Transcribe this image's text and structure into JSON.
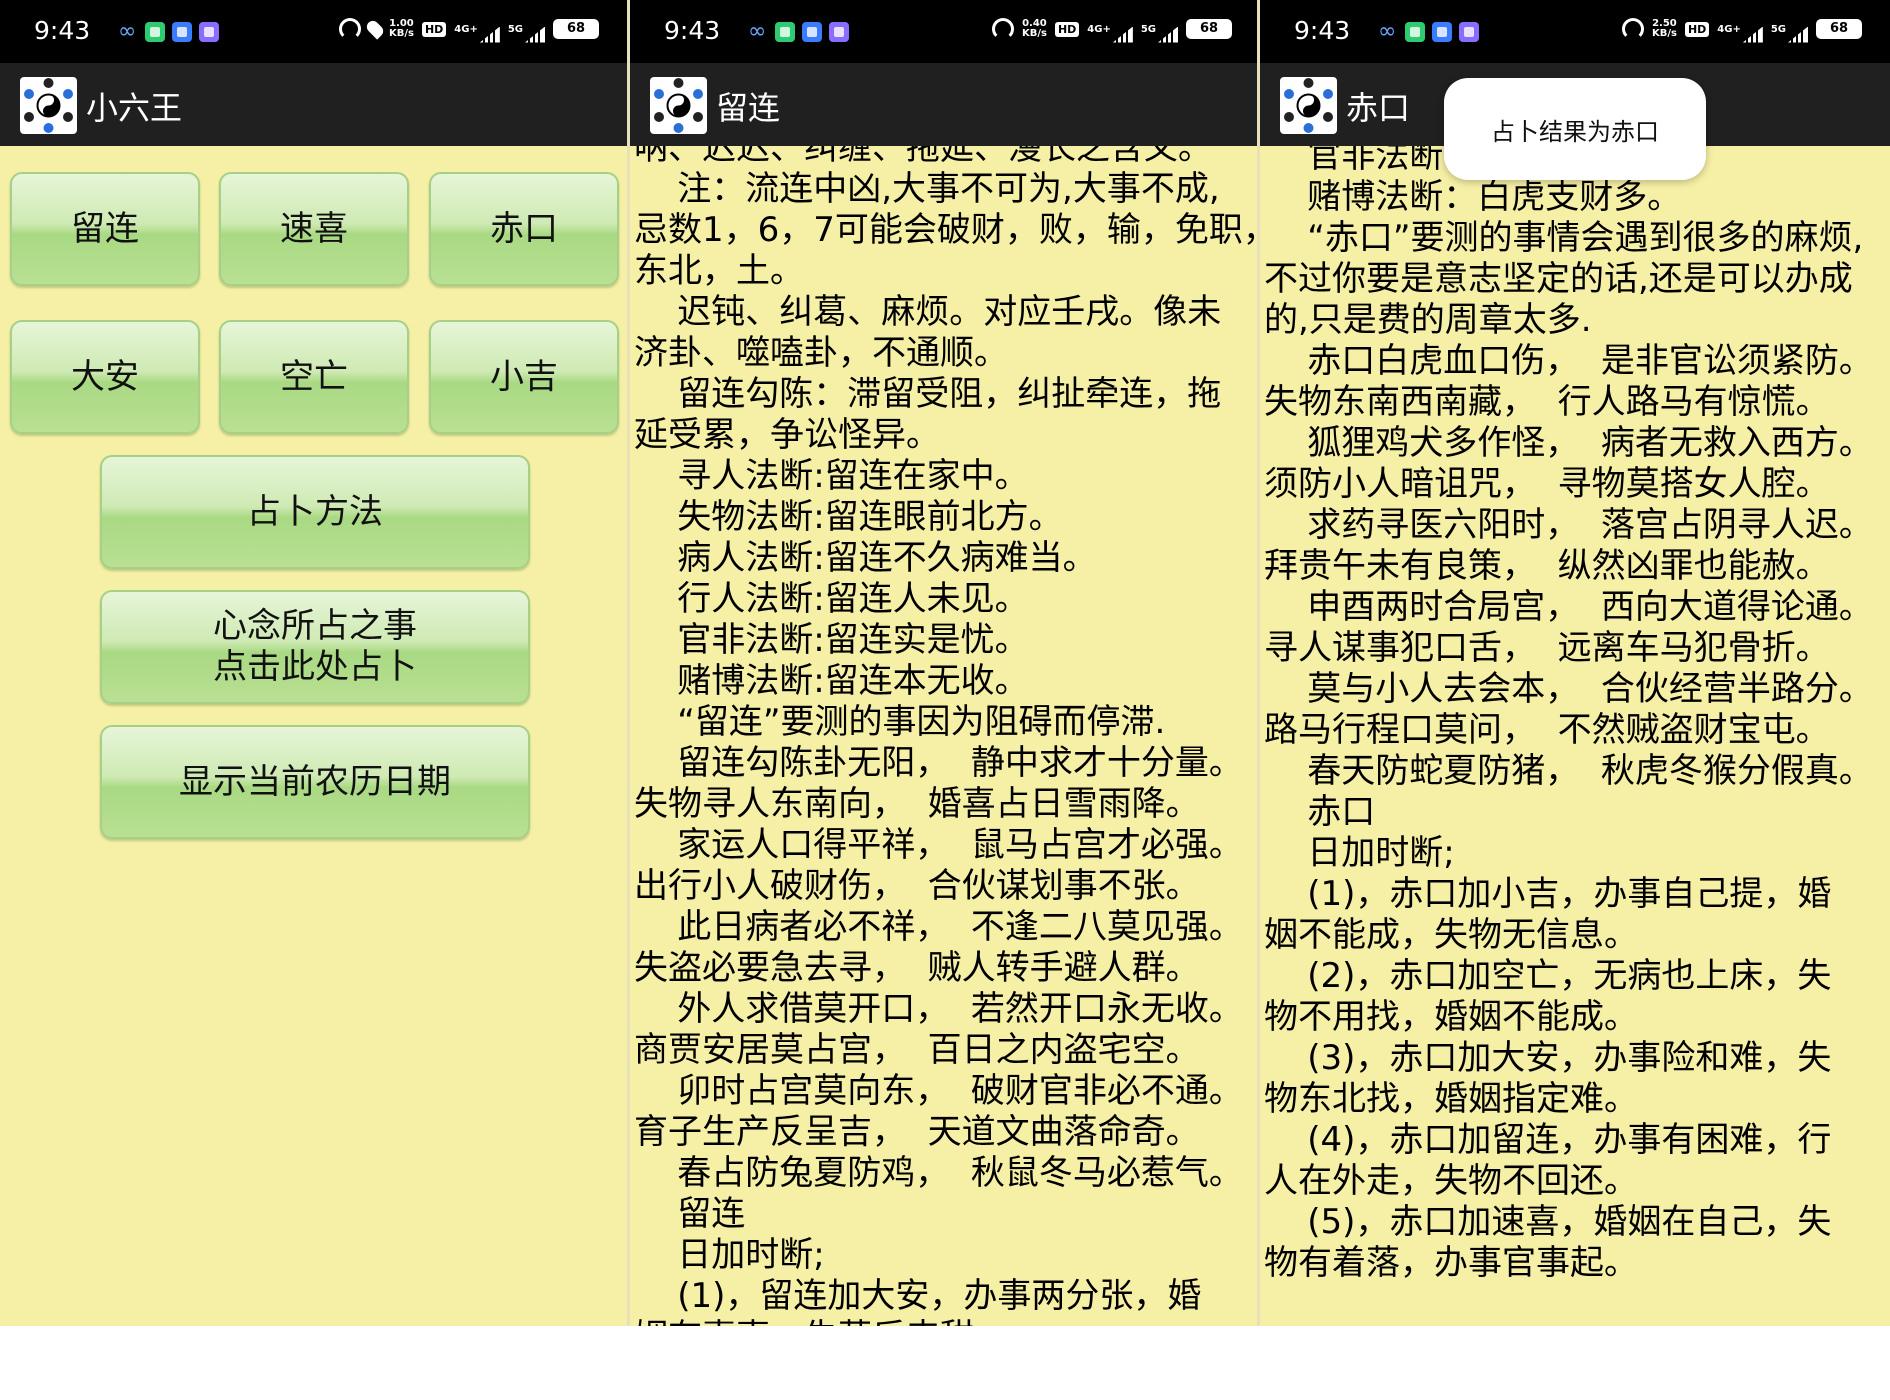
{
  "status_bar": {
    "time": "9:43",
    "battery": "68",
    "speeds": [
      "1.00",
      "0.40",
      "2.50"
    ],
    "speed_unit": "KB/s",
    "hd": "HD",
    "net_4g": "4G+",
    "net_5g": "5G"
  },
  "panels": [
    {
      "title": "小六王"
    },
    {
      "title": "留连"
    },
    {
      "title": "赤口"
    }
  ],
  "main_screen": {
    "grid_buttons": [
      "留连",
      "速喜",
      "赤口",
      "大安",
      "空亡",
      "小吉"
    ],
    "method_button": "占卜方法",
    "mind_button": "心念所占之事\n点击此处占卜",
    "lunar_button": "显示当前农历日期"
  },
  "liulian_text": [
    "呐、迟迟、纠缠、拖延、漫长之含义。",
    "    注：流连中凶,大事不可为,大事不成,",
    "忌数1，6，7可能会破财，败，输，免职，",
    "东北，土。",
    "    迟钝、纠葛、麻烦。对应壬戌。像未",
    "济卦、噬嗑卦，不通顺。",
    "    留连勾陈：滞留受阻，纠扯牵连，拖",
    "延受累，争讼怪异。",
    "    寻人法断:留连在家中。",
    "    失物法断:留连眼前北方。",
    "    病人法断:留连不久病难当。",
    "    行人法断:留连人未见。",
    "    官非法断:留连实是忧。",
    "    赌博法断:留连本无收。",
    "    “留连”要测的事因为阻碍而停滞.",
    "    留连勾陈卦无阳，  静中求才十分量。",
    "失物寻人东南向，  婚喜占日雪雨降。",
    "    家运人口得平祥，  鼠马占宫才必强。",
    "出行小人破财伤，  合伙谋划事不张。",
    "    此日病者必不祥，  不逢二八莫见强。",
    "失盗必要急去寻，  贼人转手避人群。",
    "    外人求借莫开口，  若然开口永无收。",
    "商贾安居莫占宫，  百日之内盗宅空。",
    "    卯时占宫莫向东，  破财官非必不通。",
    "育子生产反呈吉，  天道文曲落命奇。",
    "    春占防兔夏防鸡，  秋鼠冬马必惹气。",
    "    留连",
    "    日加时断;",
    "    (1)，留连加大安，办事两分张，婚",
    "姻有喜事，失落后来甜。"
  ],
  "chikou_text": [
    "    官非法断",
    "    赌博法断：白虎支财多。",
    "    “赤口”要测的事情会遇到很多的麻烦,",
    "不过你要是意志坚定的话,还是可以办成",
    "的,只是费的周章太多.",
    "    赤口白虎血口伤，  是非官讼须紧防。",
    "失物东南西南藏，  行人路马有惊慌。",
    "    狐狸鸡犬多作怪，  病者无救入西方。",
    "须防小人暗诅咒，  寻物莫搭女人腔。",
    "    求药寻医六阳时，  落宫占阴寻人迟。",
    "拜贵午未有良策，  纵然凶罪也能赦。",
    "    申酉两时合局宫，  西向大道得论通。",
    "寻人谋事犯口舌，  远离车马犯骨折。",
    "    莫与小人去会本，  合伙经营半路分。",
    "路马行程口莫问，  不然贼盗财宝屯。",
    "    春天防蛇夏防猪，  秋虎冬猴分假真。",
    "    赤口",
    "    日加时断;",
    "    (1)，赤口加小吉，办事自己提，婚",
    "姻不能成，失物无信息。",
    "    (2)，赤口加空亡，无病也上床，失",
    "物不用找，婚姻不能成。",
    "    (3)，赤口加大安，办事险和难，失",
    "物东北找，婚姻指定难。",
    "    (4)，赤口加留连，办事有困难，行",
    "人在外走，失物不回还。",
    "    (5)，赤口加速喜，婚姻在自己，失",
    "物有着落，办事官事起。"
  ],
  "toast": {
    "message": "占卜结果为赤口"
  },
  "colors": {
    "background": "#f6f0a6",
    "button": "#b9e093",
    "bar": "#202020"
  }
}
